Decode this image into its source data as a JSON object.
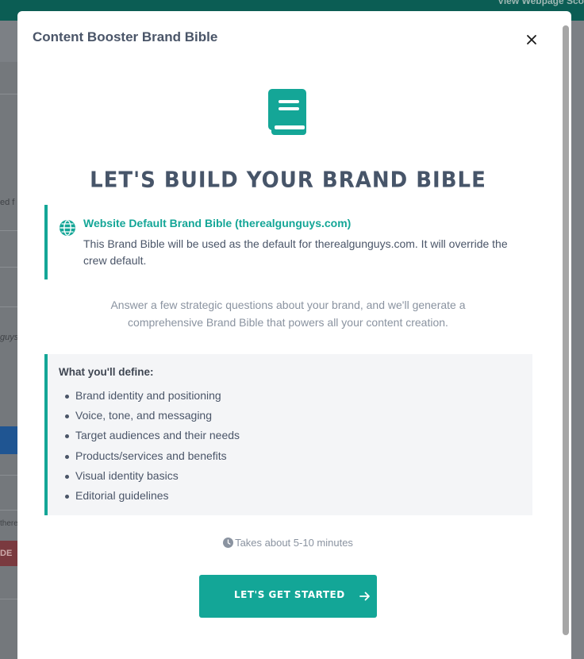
{
  "background": {
    "top_link": "View Webpage Sco",
    "fragments": [
      "ed f",
      "guys",
      "there",
      "DE"
    ]
  },
  "modal": {
    "title": "Content Booster Brand Bible",
    "headline": "LET'S BUILD YOUR BRAND BIBLE",
    "info": {
      "title": "Website Default Brand Bible (therealgunguys.com)",
      "text": "This Brand Bible will be used as the default for therealgunguys.com. It will override the crew default."
    },
    "intro": "Answer a few strategic questions about your brand, and we'll generate a comprehensive Brand Bible that powers all your content creation.",
    "define": {
      "title": "What you'll define:",
      "items": [
        "Brand identity and positioning",
        "Voice, tone, and messaging",
        "Target audiences and their needs",
        "Products/services and benefits",
        "Visual identity basics",
        "Editorial guidelines"
      ]
    },
    "time_note": "Takes about 5-10 minutes",
    "start_button": "LET'S GET STARTED"
  },
  "colors": {
    "accent": "#14a697",
    "heading": "#475569",
    "text": "#4a5568",
    "muted": "#8a93a0"
  },
  "icons": {
    "book": "book-icon",
    "globe": "globe-icon",
    "close": "close-icon",
    "clock": "clock-icon",
    "arrow": "arrow-right-icon"
  }
}
